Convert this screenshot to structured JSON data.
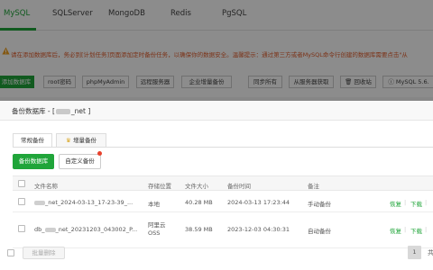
{
  "db_tabs": [
    "MySQL",
    "SQLServer",
    "MongoDB",
    "Redis",
    "PgSQL"
  ],
  "notice": "请在添加数据库后，务必到[计划任务]页面添加定时备份任务，以确保你的数据安全。温馨提示：通过第三方或者MySQL命令行创建的数据库需要点击\"从",
  "toolbar": {
    "add_db": "添加数据库",
    "root_pwd": "root密码",
    "phpmyadmin": "phpMyAdmin",
    "remote_server": "远程服务器",
    "enterprise_backup": "企业增量备份",
    "sync_all": "同步所有",
    "fetch_from_server": "从服务器获取",
    "recycle_bin": "回收站",
    "mysql_version": "MySQL 5.6."
  },
  "modal": {
    "title_prefix": "备份数据库 - [",
    "title_suffix": "_net ]",
    "tabs": [
      "常规备份",
      "增量备份"
    ],
    "backup_button": "备份数据库",
    "custom_backup_button": "自定义备份",
    "columns": [
      "文件名称",
      "存储位置",
      "文件大小",
      "备份时间",
      "备注"
    ],
    "rows": [
      {
        "name_prefix": "",
        "name_suffix": "_net_2024-03-13_17-23-39_...",
        "location": "本地",
        "size": "40.28 MB",
        "time": "2024-03-13 17:23:44",
        "note": "手动备份",
        "restore": "恢复",
        "download": "下载"
      },
      {
        "name_prefix": "db_",
        "name_suffix": "_net_20231203_043002_P...",
        "location": "阿里云OSS",
        "size": "38.59 MB",
        "time": "2023-12-03 04:30:31",
        "note": "自动备份",
        "restore": "恢复",
        "download": "下载"
      }
    ],
    "batch_delete": "批量删除",
    "page": "1",
    "total_label": "共"
  }
}
